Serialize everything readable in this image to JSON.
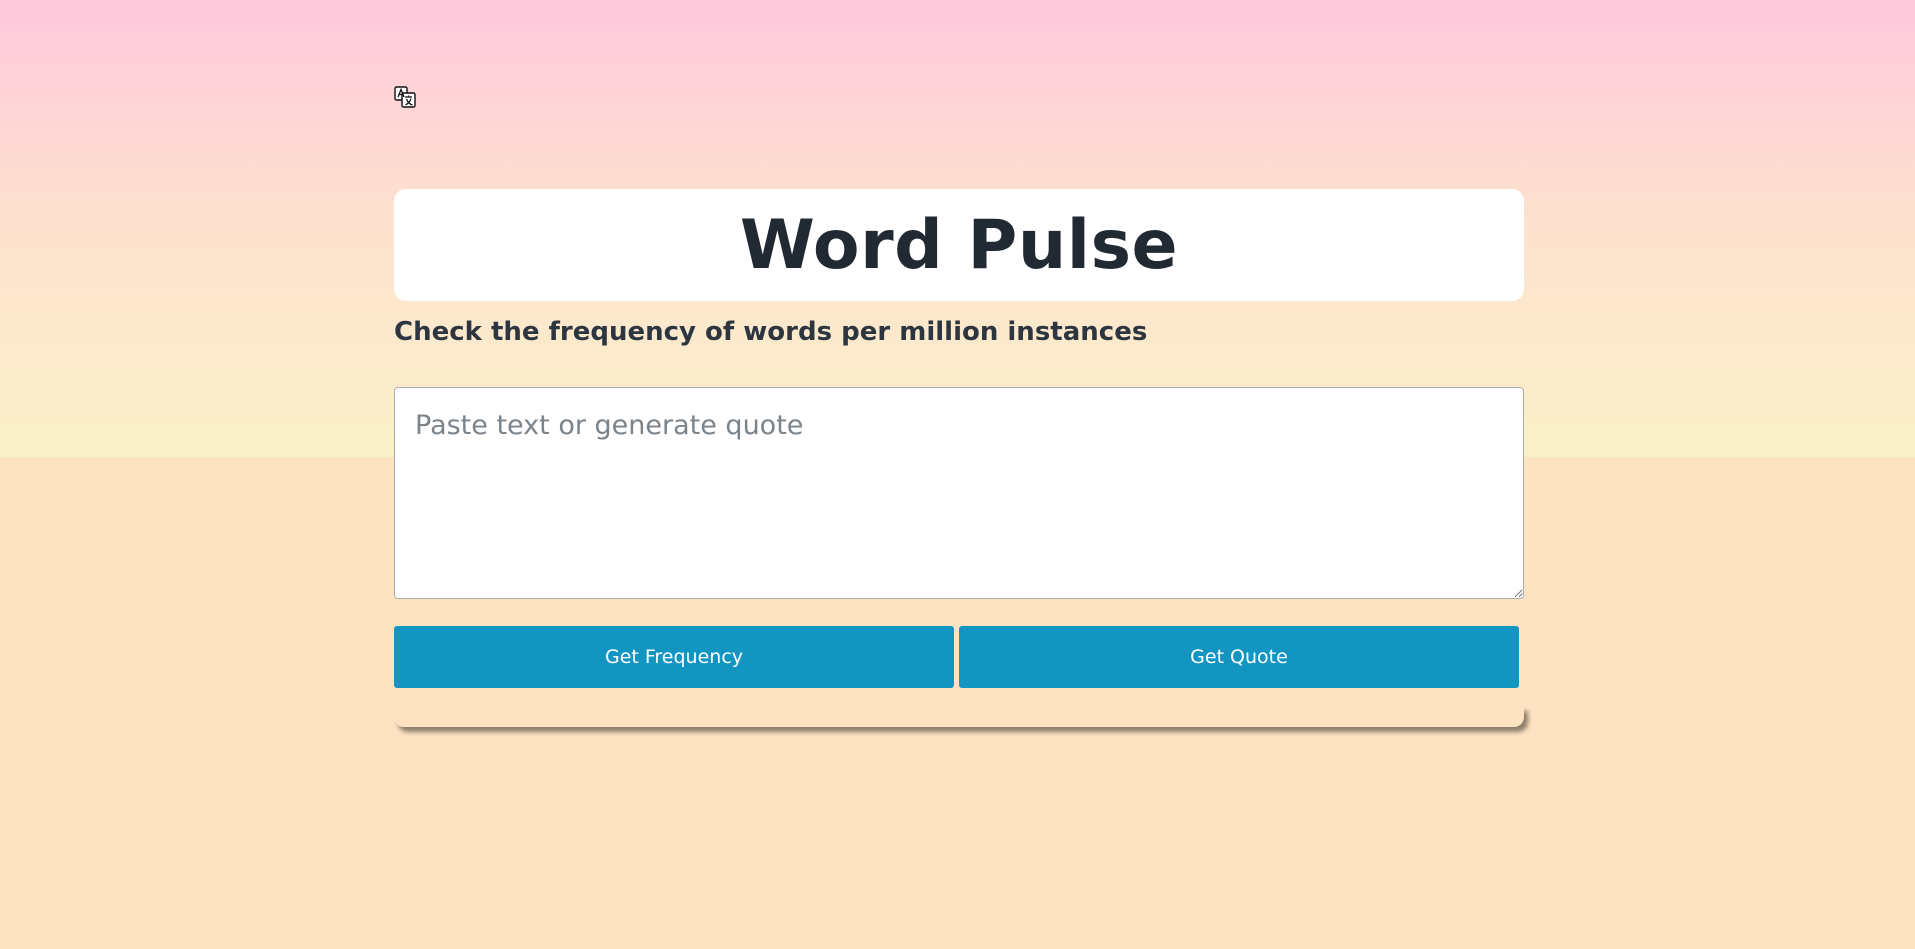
{
  "app": {
    "title": "Word Pulse",
    "subtitle": "Check the frequency of words per million instances"
  },
  "input": {
    "value": "",
    "placeholder": "Paste text or generate quote"
  },
  "buttons": {
    "frequency_label": "Get Frequency",
    "quote_label": "Get Quote"
  },
  "icons": {
    "translate": "translate-icon"
  },
  "colors": {
    "button": "#1295c1",
    "title_text": "#212a33",
    "background": "#fde3c1"
  }
}
